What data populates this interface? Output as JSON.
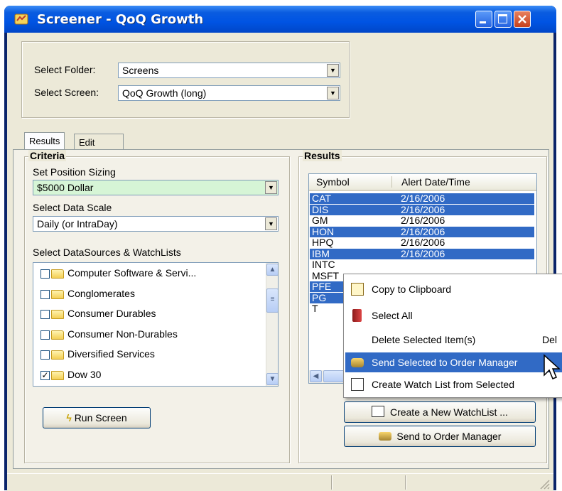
{
  "window": {
    "title": "Screener - QoQ Growth"
  },
  "selection": {
    "folder_label": "Select Folder:",
    "folder_value": "Screens",
    "screen_label": "Select Screen:",
    "screen_value": "QoQ Growth (long)"
  },
  "tabs": [
    {
      "label": "Results",
      "active": true
    },
    {
      "label": "Edit",
      "active": false
    }
  ],
  "criteria": {
    "title": "Criteria",
    "position_sizing_label": "Set Position Sizing",
    "position_sizing_value": "$5000 Dollar",
    "position_sizing_bg": "#d6f5d6",
    "data_scale_label": "Select Data Scale",
    "data_scale_value": "Daily (or IntraDay)",
    "datasources_label": "Select DataSources & WatchLists",
    "datasources": [
      {
        "label": "Computer Software & Servi...",
        "checked": false
      },
      {
        "label": "Conglomerates",
        "checked": false
      },
      {
        "label": "Consumer Durables",
        "checked": false
      },
      {
        "label": "Consumer Non-Durables",
        "checked": false
      },
      {
        "label": "Diversified Services",
        "checked": false
      },
      {
        "label": "Dow 30",
        "checked": true
      }
    ],
    "run_button": "Run Screen"
  },
  "results": {
    "title": "Results",
    "columns": [
      "Symbol",
      "Alert Date/Time"
    ],
    "rows": [
      {
        "symbol": "CAT",
        "date": "2/16/2006",
        "selected": true
      },
      {
        "symbol": "DIS",
        "date": "2/16/2006",
        "selected": true
      },
      {
        "symbol": "GM",
        "date": "2/16/2006",
        "selected": false
      },
      {
        "symbol": "HON",
        "date": "2/16/2006",
        "selected": true
      },
      {
        "symbol": "HPQ",
        "date": "2/16/2006",
        "selected": false
      },
      {
        "symbol": "IBM",
        "date": "2/16/2006",
        "selected": true
      },
      {
        "symbol": "INTC",
        "date": "",
        "selected": false
      },
      {
        "symbol": "MSFT",
        "date": "",
        "selected": false
      },
      {
        "symbol": "PFE",
        "date": "",
        "selected": true
      },
      {
        "symbol": "PG",
        "date": "",
        "selected": true
      },
      {
        "symbol": "T",
        "date": "",
        "selected": false
      }
    ],
    "create_watchlist_button": "Create a New WatchList ...",
    "send_order_button": "Send to Order Manager"
  },
  "context_menu": {
    "items": [
      {
        "label": "Copy to Clipboard",
        "icon": "clipboard-icon",
        "shortcut": ""
      },
      {
        "label": "Select All",
        "icon": "book-icon",
        "shortcut": ""
      },
      {
        "label": "Delete Selected Item(s)",
        "icon": "",
        "shortcut": "Del"
      },
      {
        "label": "Send Selected to Order Manager",
        "icon": "order-manager-icon",
        "shortcut": "",
        "highlighted": true
      },
      {
        "label": "Create Watch List from Selected",
        "icon": "watchlist-icon",
        "shortcut": ""
      }
    ]
  },
  "colors": {
    "title_blue": "#0054e3",
    "selection_blue": "#316ac5",
    "face": "#ece9d8"
  }
}
